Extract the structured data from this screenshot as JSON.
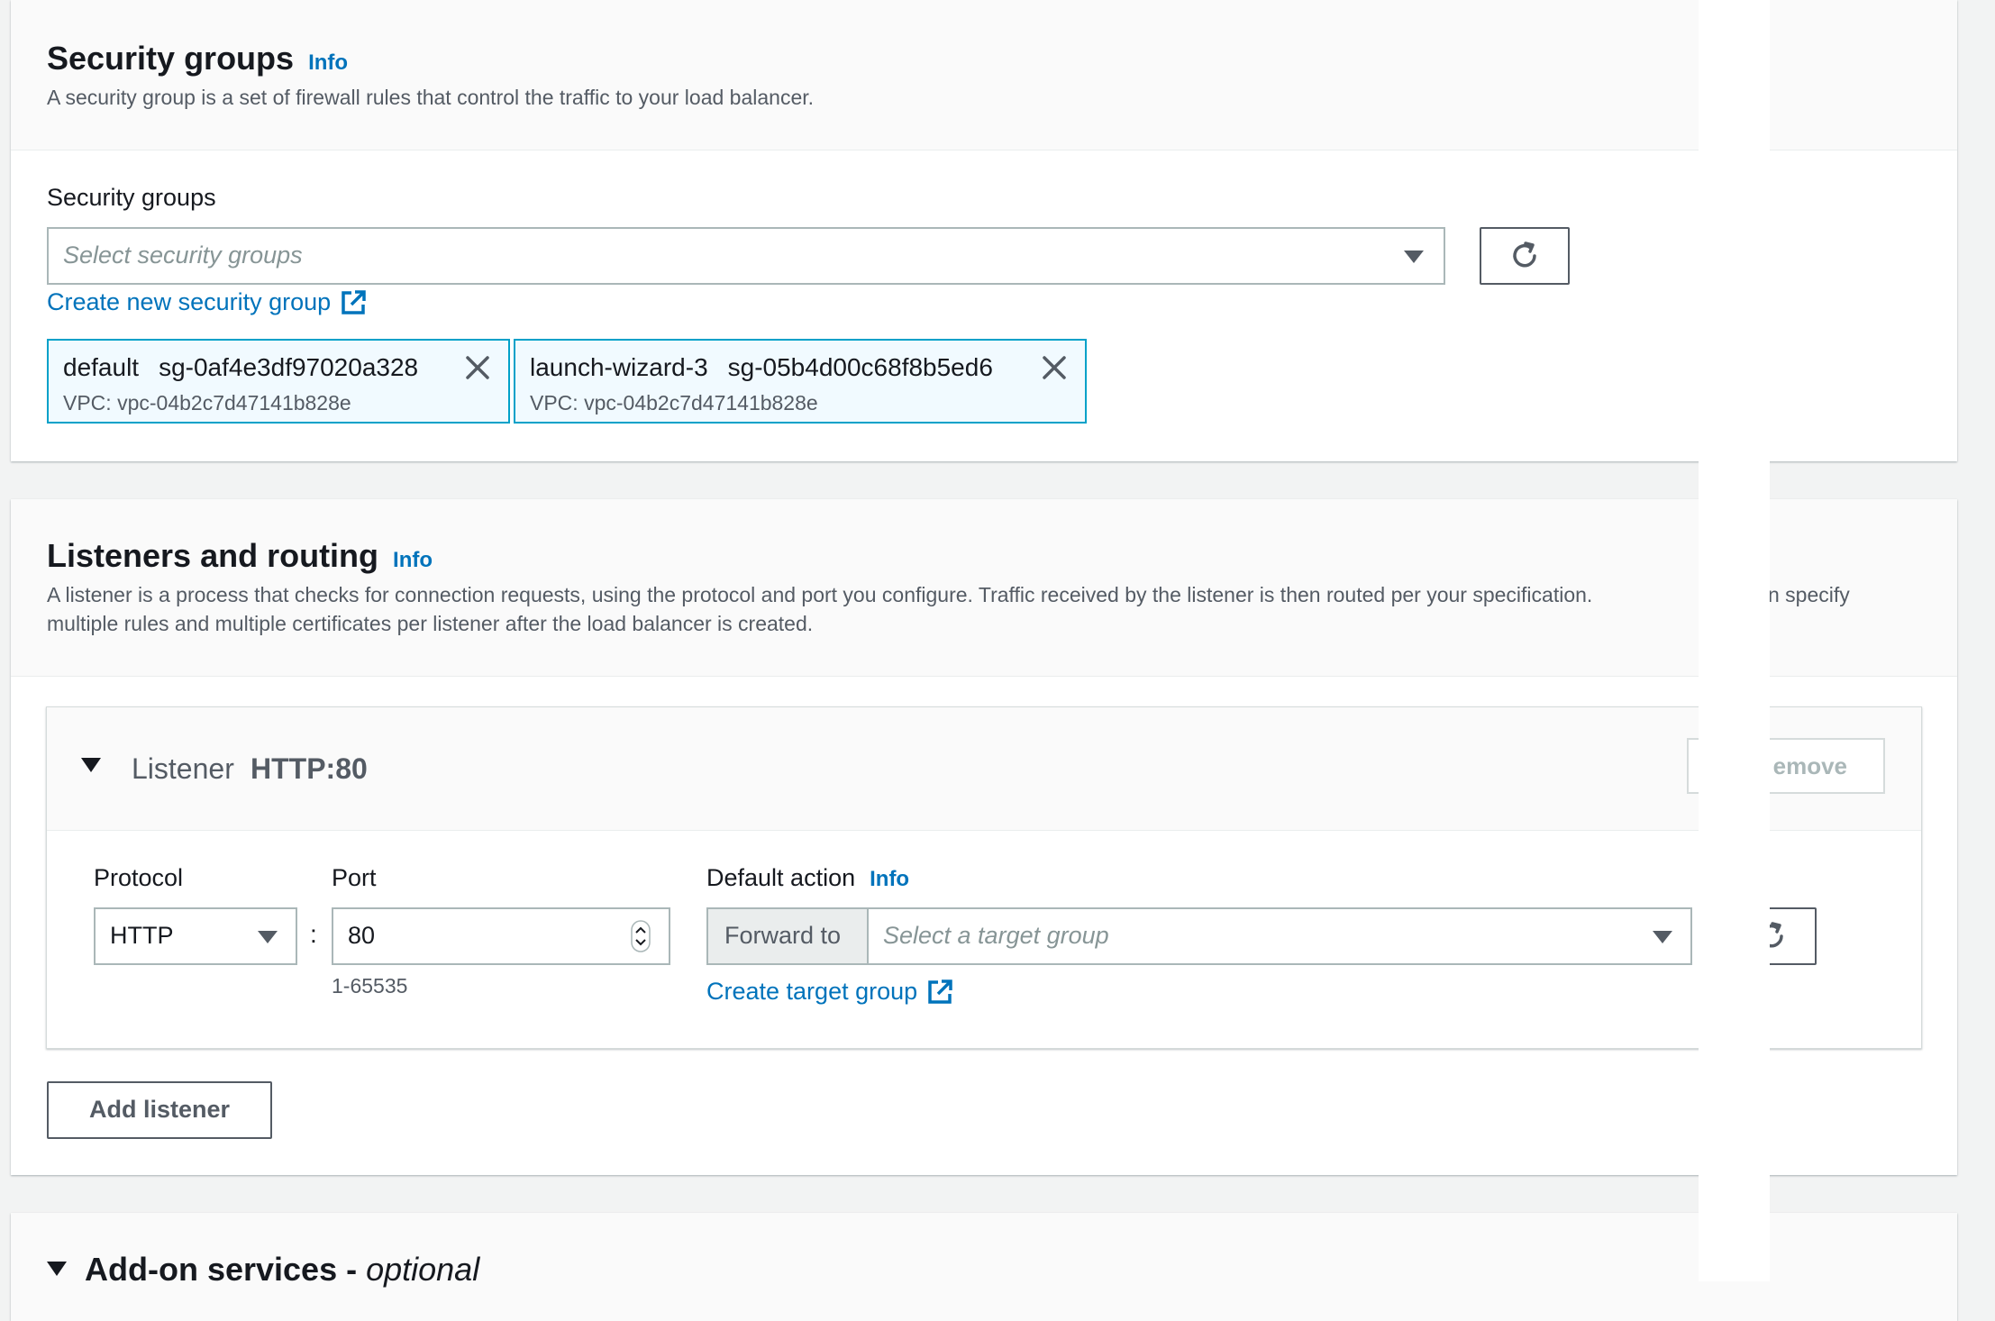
{
  "security": {
    "title": "Security groups",
    "info": "Info",
    "description": "A security group is a set of firewall rules that control the traffic to your load balancer.",
    "field_label": "Security groups",
    "placeholder": "Select security groups",
    "create_link": "Create new security group",
    "tokens": [
      {
        "name": "default",
        "id": "sg-0af4e3df97020a328",
        "vpc": "VPC: vpc-04b2c7d47141b828e"
      },
      {
        "name": "launch-wizard-3",
        "id": "sg-05b4d00c68f8b5ed6",
        "vpc": "VPC: vpc-04b2c7d47141b828e"
      }
    ]
  },
  "listeners": {
    "title": "Listeners and routing",
    "info": "Info",
    "description_line1": "A listener is a process that checks for connection requests, using the protocol and port you configure. Traffic received by the listener is then routed per your specification.",
    "description_tail": "n specify",
    "description_line2": "multiple rules and multiple certificates per listener after the load balancer is created.",
    "listener": {
      "label": "Listener",
      "name": "HTTP:80",
      "remove_label": "emove",
      "protocol_label": "Protocol",
      "protocol_value": "HTTP",
      "separator": ":",
      "port_label": "Port",
      "port_value": "80",
      "port_hint": "1-65535",
      "default_action_label": "Default action",
      "default_action_info": "Info",
      "forward_to": "Forward to",
      "target_placeholder": "Select a target group",
      "create_target_link": "Create target group"
    },
    "add_listener_label": "Add listener"
  },
  "addons": {
    "title": "Add-on services - ",
    "title_suffix": "optional"
  }
}
